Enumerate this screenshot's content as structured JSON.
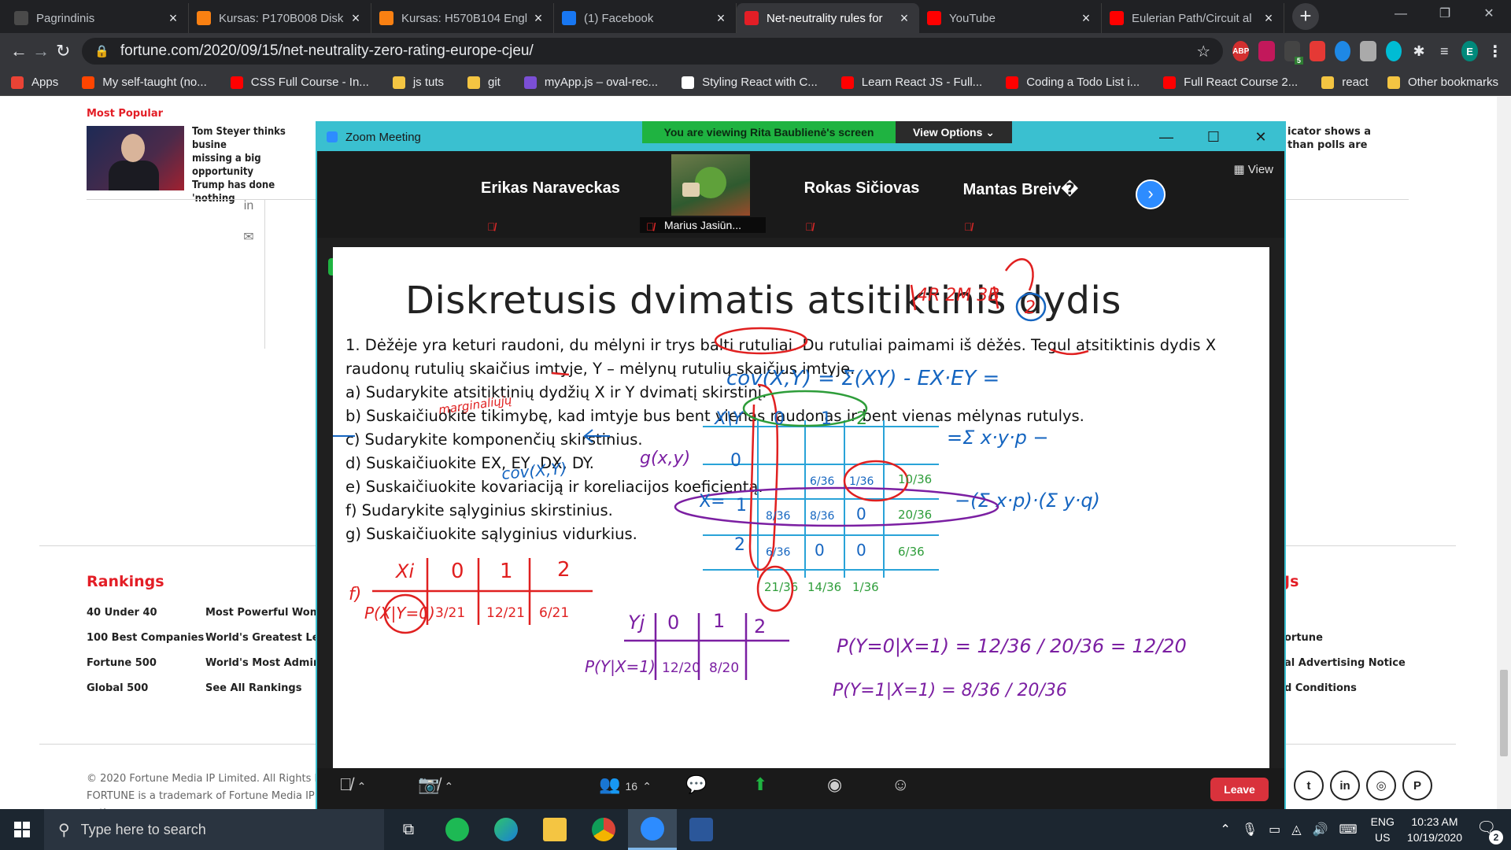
{
  "browser": {
    "tabs": [
      {
        "title": "Pagrindinis",
        "color": "#4a4a4a",
        "icon": "moodle-icon"
      },
      {
        "title": "Kursas: P170B008 Disk",
        "color": "#f98012",
        "icon": "moodle-icon"
      },
      {
        "title": "Kursas: H570B104 Engl",
        "color": "#f98012",
        "icon": "moodle-icon"
      },
      {
        "title": "(1) Facebook",
        "color": "#1877f2",
        "icon": "facebook-icon"
      },
      {
        "title": "Net-neutrality rules for",
        "color": "#e31e26",
        "icon": "fortune-icon"
      },
      {
        "title": "YouTube",
        "color": "#ff0000",
        "icon": "youtube-icon"
      },
      {
        "title": "Eulerian Path/Circuit al",
        "color": "#ff0000",
        "icon": "youtube-icon"
      }
    ],
    "active_tab_index": 4,
    "url": "fortune.com/2020/09/15/net-neutrality-zero-rating-europe-cjeu/",
    "profile_initial": "E",
    "ext_badge": "5",
    "abp_label": "ABP",
    "bookmarks": [
      {
        "label": "Apps",
        "color": "#ea4335"
      },
      {
        "label": "My self-taught (no...",
        "color": "#ff4500"
      },
      {
        "label": "CSS Full Course - In...",
        "color": "#ff0000"
      },
      {
        "label": "js tuts",
        "color": "#f4c542"
      },
      {
        "label": "git",
        "color": "#f4c542"
      },
      {
        "label": "myApp.js – oval-rec...",
        "color": "#7b4fd6"
      },
      {
        "label": "Styling React with C...",
        "color": "#ffffff"
      },
      {
        "label": "Learn React JS - Full...",
        "color": "#ff0000"
      },
      {
        "label": "Coding a Todo List i...",
        "color": "#ff0000"
      },
      {
        "label": "Full React Course 2...",
        "color": "#ff0000"
      },
      {
        "label": "react",
        "color": "#f4c542"
      }
    ],
    "other_bookmarks": "Other bookmarks"
  },
  "fortune": {
    "most_popular": "Most Popular",
    "article_left": [
      "Tom Steyer thinks busine",
      "missing a big opportunity",
      "Trump has done 'nothing"
    ],
    "article_right": [
      "icator shows a",
      "than polls are"
    ],
    "rankings_title": "Rankings",
    "rankings_col1": [
      "40 Under 40",
      "100 Best Companies",
      "Fortune 500",
      "Global 500"
    ],
    "rankings_col2": [
      "Most Powerful Women",
      "World's Greatest Lead",
      "World's Most Admired",
      "See All Rankings"
    ],
    "right_title": "Js",
    "right_links": [
      "ortune",
      "al Advertising Notice",
      "d Conditions"
    ],
    "copyright": "© 2020 Fortune Media IP Limited. All Rights Re",
    "trademark": "FORTUNE is a trademark of Fortune Media IP Li",
    "notice": "notice"
  },
  "zoom": {
    "window_title": "Zoom Meeting",
    "viewing_banner": "You are viewing Rita Baublienė's screen",
    "view_options": "View Options ⌄",
    "view_button": "View",
    "participants": [
      {
        "name": "Erikas Naraveckas"
      },
      {
        "name": "Marius Jasiūn..."
      },
      {
        "name": "Rokas Sičiovas"
      },
      {
        "name": "Mantas Breiv�"
      }
    ],
    "participant_count": "16",
    "leave_label": "Leave"
  },
  "slide": {
    "title": "Diskretusis dvimatis atsitiktinis dydis",
    "lines": [
      "1. Dėžėje yra keturi raudoni, du mėlyni ir trys balti rutuliai. Du rutuliai paimami iš dėžės. Tegul atsitiktinis dydis X",
      "raudonų  rutulių skaičius imtyje, Y – mėlynų rutulių skaičius imtyje.",
      "a) Sudarykite atsitiktinių dydžių X ir Y dvimatį skirstinį.",
      "b) Suskaičiuokite tikimybę, kad imtyje bus bent vienas raudonas ir bent vienas mėlynas rutulys.",
      "c) Sudarykite komponenčių skirstinius.",
      "d) Suskaičiuokite EX, EY, DX, DY.",
      "e) Suskaičiuokite kovariaciją ir koreliacijos koeficientą.",
      "f) Sudarykite sąlyginius skirstinius.",
      "g) Suskaičiuokite sąlyginius vidurkius."
    ],
    "ink_red_header": "4R 2M 3B",
    "ink_red_circle": "2",
    "ink_cov": "cov(X,Y) = Σ(XY) - EX·EY =",
    "ink_marginal": "marginaliųjų",
    "ink_cov2": "cov(X,Y)",
    "ink_g": "g(x,y)",
    "ink_sum1": "=Σ x·y·p −",
    "ink_sum2": "−(Σ x·p)·(Σ y·q)",
    "table_header_x": "X\\Y",
    "table_cols": [
      "0",
      "1",
      "2"
    ],
    "table_rows": [
      "0",
      "1",
      "2"
    ],
    "table_cells": [
      [
        "",
        "6/36",
        "1/36"
      ],
      [
        "8/36",
        "8/36",
        "0"
      ],
      [
        "6/36",
        "0",
        "0"
      ]
    ],
    "table_right_marg": [
      "10/36",
      "20/36",
      "6/36"
    ],
    "table_bottom_marg": [
      "21/36",
      "14/36",
      "1/36"
    ],
    "x_dist": {
      "label": "Xi",
      "vals": [
        "0",
        "1",
        "2"
      ],
      "probs": [
        "3/21",
        "12/21",
        "6/21"
      ],
      "row_label": "P(X|Y=0)",
      "f": "f)"
    },
    "y_dist": {
      "label": "Yj",
      "vals": [
        "0",
        "1",
        "2"
      ],
      "probs": [
        "12/20",
        "8/20",
        ""
      ],
      "row_label": "P(Y|X=1)"
    },
    "cond1": "P(Y=0|X=1) = 12/36 / 20/36 = 12/20",
    "cond2": "P(Y=1|X=1) = 8/36 / 20/36"
  },
  "taskbar": {
    "search_placeholder": "Type here to search",
    "lang": "ENG",
    "region": "US",
    "time": "10:23 AM",
    "date": "10/19/2020",
    "notifications": "2"
  }
}
